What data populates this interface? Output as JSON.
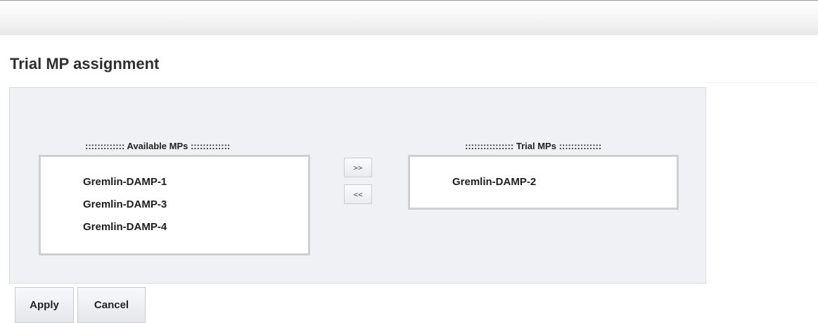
{
  "page": {
    "title": "Trial MP assignment"
  },
  "available_list": {
    "label": "::::::::::::: Available MPs :::::::::::::",
    "items": [
      "Gremlin-DAMP-1",
      "Gremlin-DAMP-3",
      "Gremlin-DAMP-4"
    ]
  },
  "trial_list": {
    "label": ":::::::::::::::: Trial MPs ::::::::::::::",
    "items": [
      "Gremlin-DAMP-2"
    ]
  },
  "move_buttons": {
    "add": ">>",
    "remove": "<<"
  },
  "actions": {
    "apply": "Apply",
    "cancel": "Cancel"
  }
}
